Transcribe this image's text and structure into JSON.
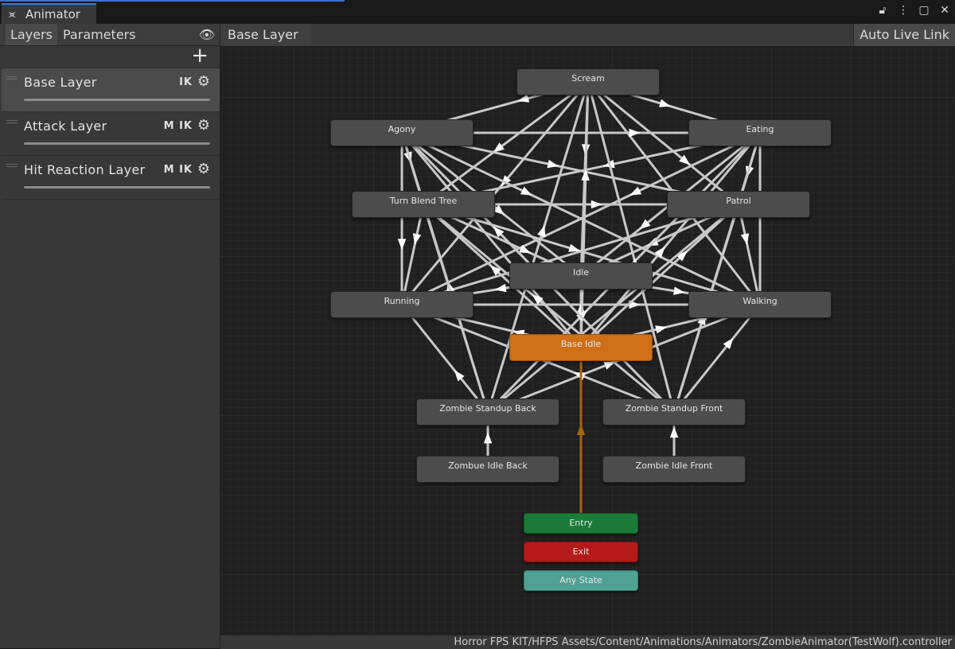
{
  "window": {
    "tab_title": "Animator",
    "tab_icon": "animator-icon",
    "controls": [
      "lock-icon",
      "kebab-menu-icon",
      "maximize-icon",
      "close-icon"
    ]
  },
  "sidebar": {
    "tabs": [
      "Layers",
      "Parameters"
    ],
    "eye_icon": "eye-icon",
    "add_icon": "plus-icon",
    "layers": [
      {
        "name": "Base Layer",
        "flags": "IK"
      },
      {
        "name": "Attack Layer",
        "flags": "M IK"
      },
      {
        "name": "Hit Reaction Layer",
        "flags": "M IK"
      }
    ]
  },
  "graph": {
    "breadcrumb": "Base Layer",
    "auto_live_link": "Auto Live Link",
    "states": [
      "Scream",
      "Agony",
      "Eating",
      "Turn Blend Tree",
      "Patrol",
      "Idle",
      "Running",
      "Walking",
      "Base Idle",
      "Zombie Standup Back",
      "Zombie Standup Front",
      "Zombue Idle Back",
      "Zombie Idle Front",
      "Entry",
      "Exit",
      "Any State"
    ],
    "default_state": "Base Idle",
    "colors": {
      "default_state": "#cf6f17",
      "entry": "#1a7b36",
      "exit": "#b51a1a",
      "any_state": "#4fa194",
      "transition": "#c8c8c8",
      "default_transition": "#a8650e"
    }
  },
  "status_bar": {
    "path": "Horror FPS KIT/HFPS Assets/Content/Animations/Animators/ZombieAnimator(TestWolf).controller"
  }
}
